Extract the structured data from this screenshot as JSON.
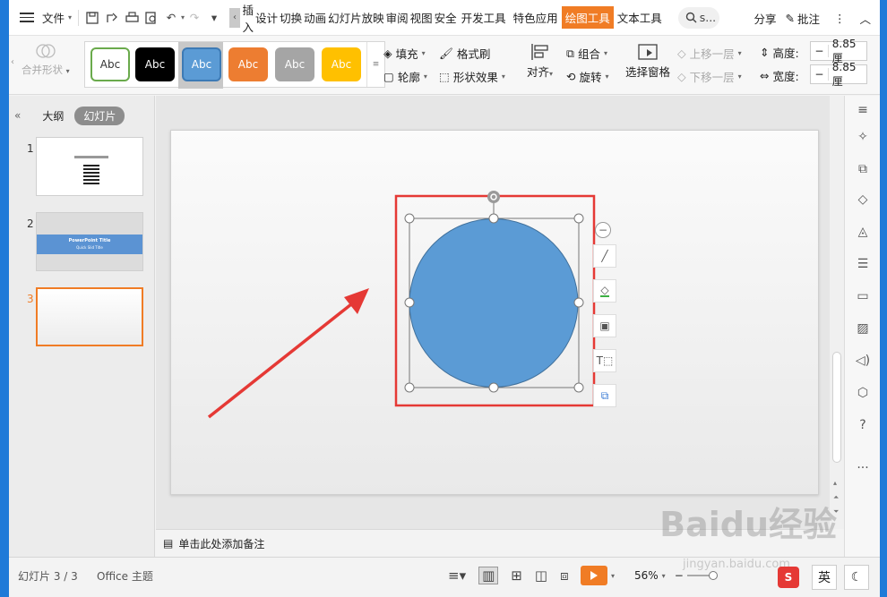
{
  "menubar": {
    "file_label": "文件",
    "tabs": [
      "插入",
      "设计",
      "切换",
      "动画",
      "幻灯片放映",
      "审阅",
      "视图",
      "安全",
      "开发工具",
      "特色应用",
      "绘图工具",
      "文本工具"
    ],
    "active_tab": "绘图工具",
    "search_label": "s...",
    "share_label": "分享",
    "comment_label": "批注"
  },
  "ribbon": {
    "merge_shape_label": "合并形状",
    "style_swatches": [
      {
        "label": "Abc",
        "bg": "#ffffff",
        "fg": "#333333",
        "border": "#6aaa4c"
      },
      {
        "label": "Abc",
        "bg": "#000000",
        "fg": "#ffffff",
        "border": "#000000"
      },
      {
        "label": "Abc",
        "bg": "#5b9bd5",
        "fg": "#ffffff",
        "border": "#3d7ab5"
      },
      {
        "label": "Abc",
        "bg": "#ed7d31",
        "fg": "#ffffff",
        "border": "#ed7d31"
      },
      {
        "label": "Abc",
        "bg": "#a5a5a5",
        "fg": "#ffffff",
        "border": "#a5a5a5"
      },
      {
        "label": "Abc",
        "bg": "#ffc000",
        "fg": "#ffffff",
        "border": "#ffc000"
      }
    ],
    "fill_label": "填充",
    "format_painter_label": "格式刷",
    "outline_label": "轮廓",
    "shape_effects_label": "形状效果",
    "align_label": "对齐",
    "group_label": "组合",
    "rotate_label": "旋转",
    "selection_pane_label": "选择窗格",
    "bring_forward_label": "上移一层",
    "send_backward_label": "下移一层",
    "height_label": "高度:",
    "height_value": "8.85厘",
    "width_label": "宽度:",
    "width_value": "8.85厘"
  },
  "leftpane": {
    "outline_tab": "大纲",
    "slides_tab": "幻灯片",
    "slides": [
      {
        "num": "1"
      },
      {
        "num": "2",
        "title": "PowerPoint Title",
        "subtitle": "Quick Slid Title"
      },
      {
        "num": "3"
      }
    ]
  },
  "notes": {
    "placeholder": "单击此处添加备注"
  },
  "statusbar": {
    "slide_counter": "幻灯片 3 / 3",
    "theme": "Office 主题",
    "zoom": "56%",
    "ime": "英"
  },
  "watermark": {
    "brand": "Baidu经验",
    "url": "jingyan.baidu.com"
  },
  "colors": {
    "accent": "#f07c25",
    "shape_fill": "#5b9bd5",
    "selection_box": "#e53935",
    "arrow": "#e53935"
  }
}
